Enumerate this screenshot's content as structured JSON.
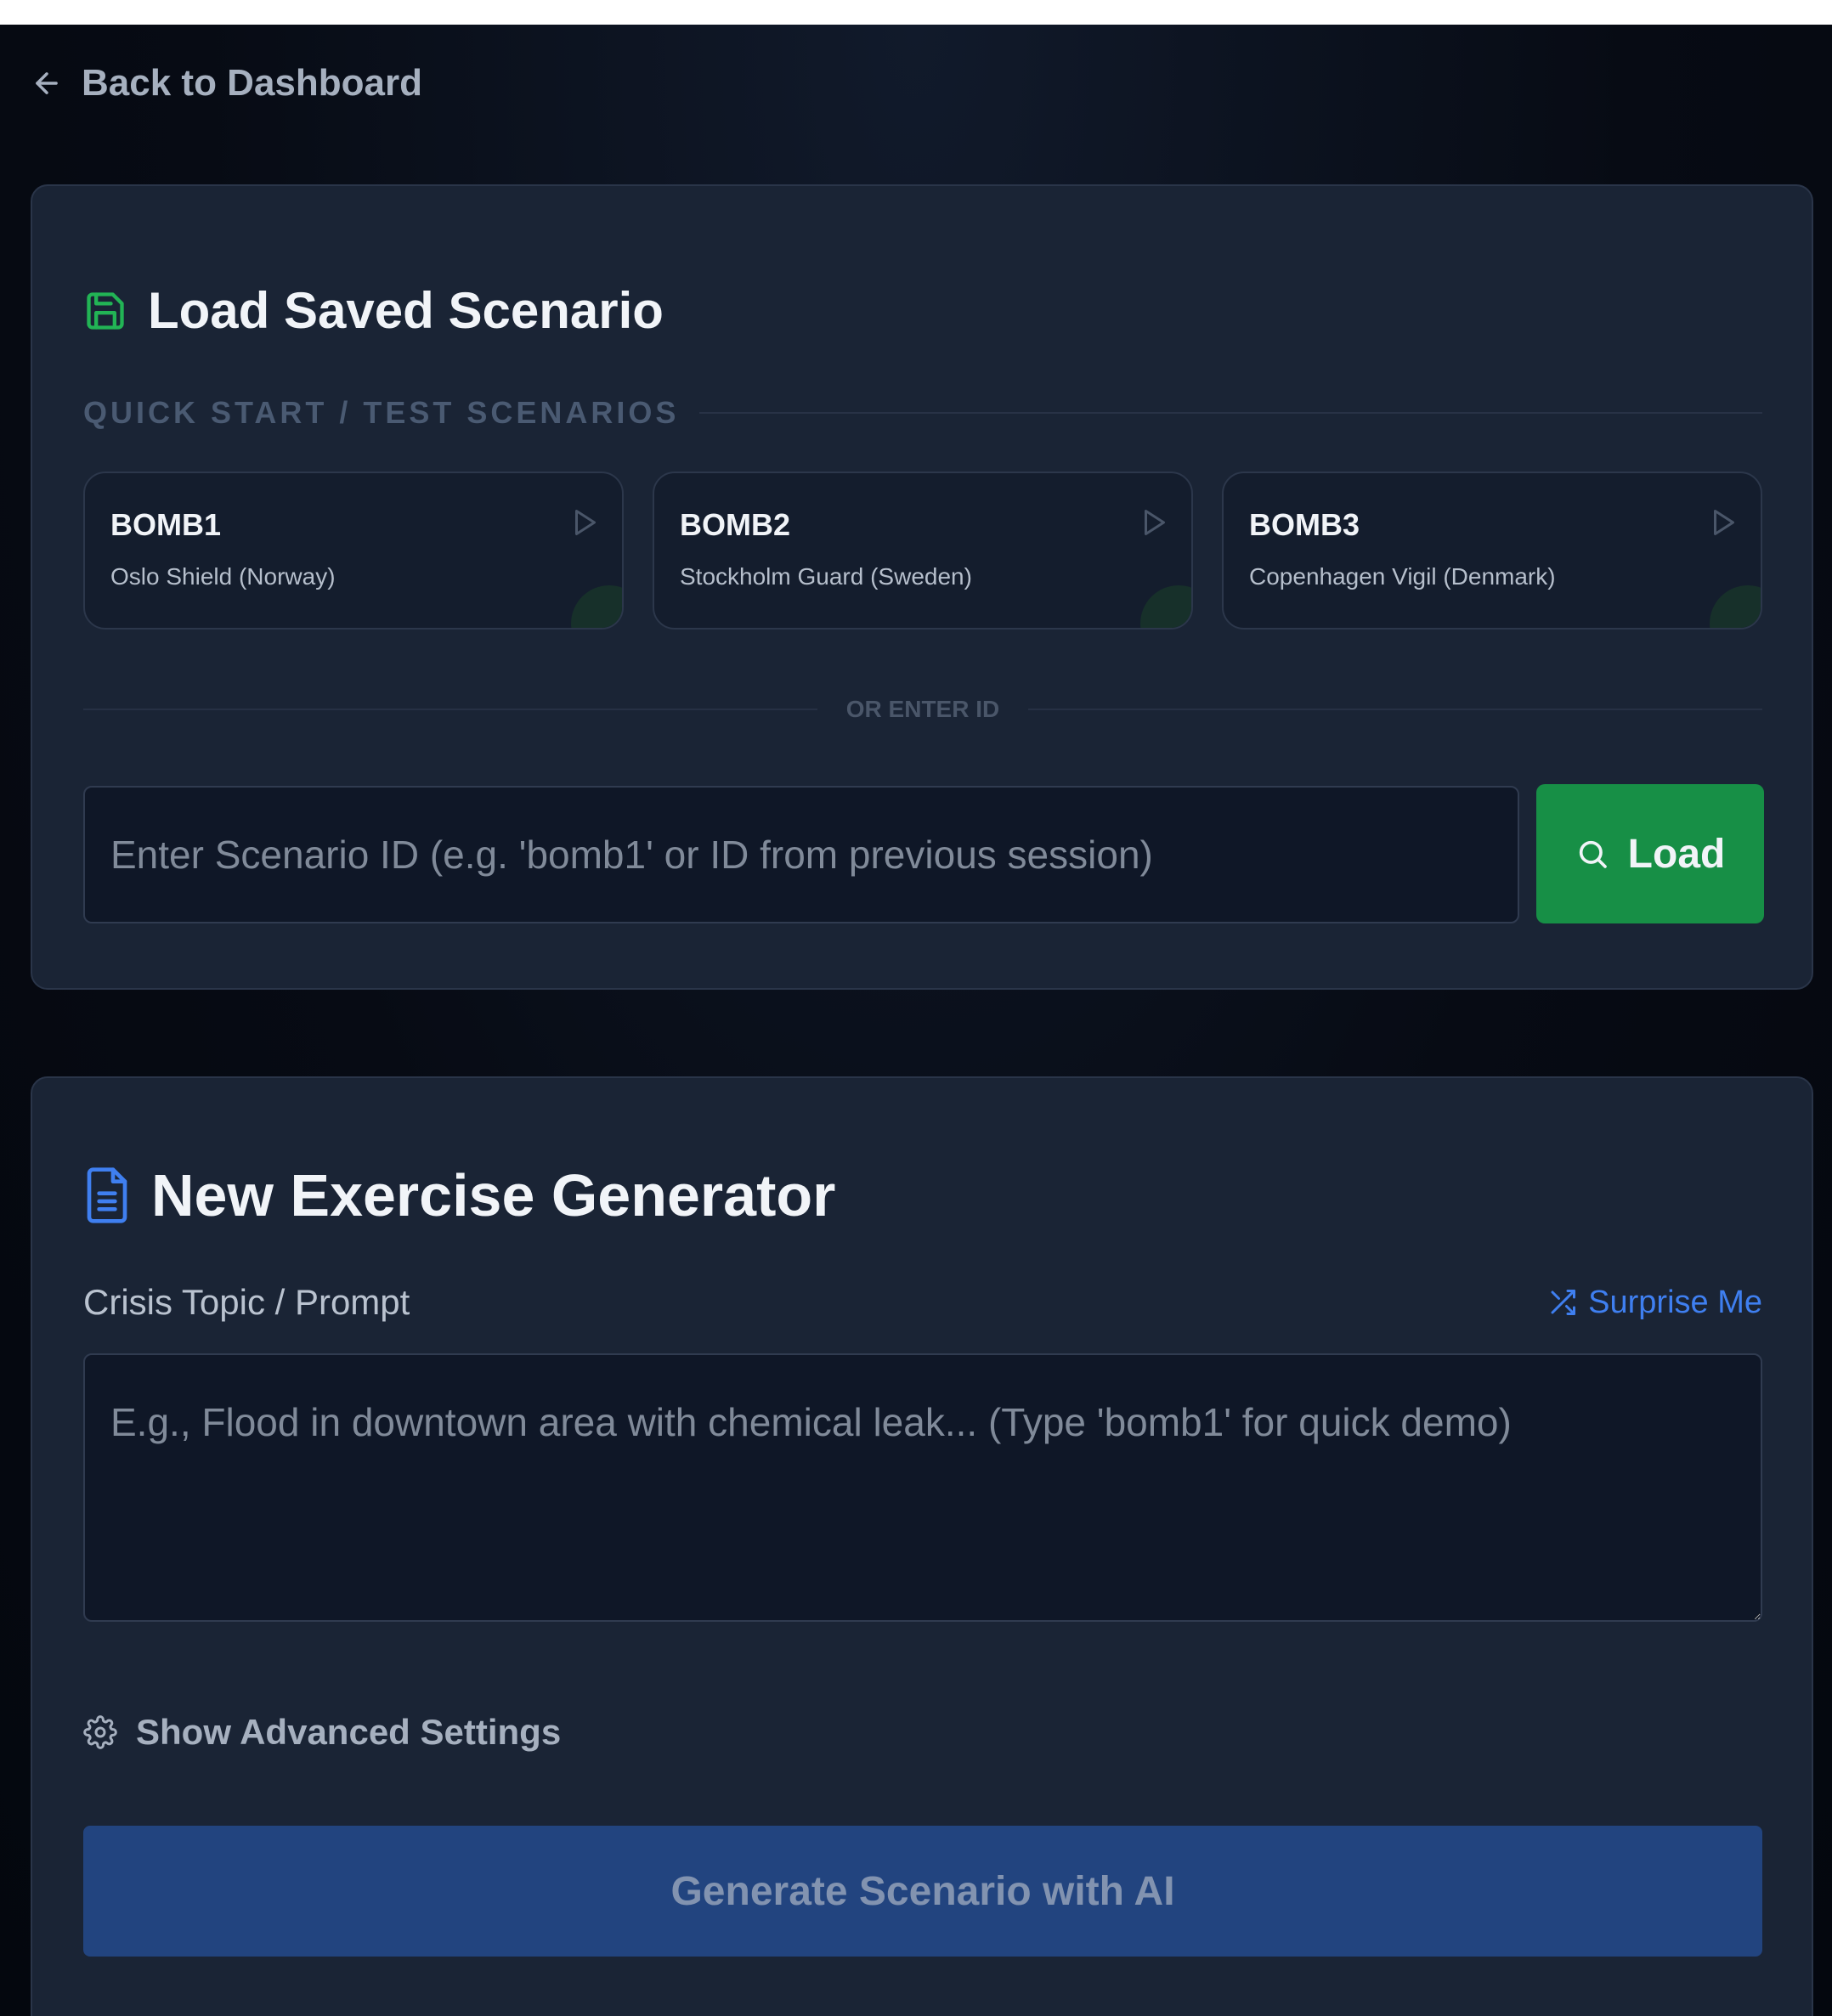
{
  "nav": {
    "back_label": "Back to Dashboard"
  },
  "load_panel": {
    "title": "Load Saved Scenario",
    "quick_start_label": "QUICK START / TEST SCENARIOS",
    "scenarios": [
      {
        "id": "BOMB1",
        "name": "Oslo Shield (Norway)"
      },
      {
        "id": "BOMB2",
        "name": "Stockholm Guard (Sweden)"
      },
      {
        "id": "BOMB3",
        "name": "Copenhagen Vigil (Denmark)"
      }
    ],
    "divider_label": "OR ENTER ID",
    "id_input": {
      "value": "",
      "placeholder": "Enter Scenario ID (e.g. 'bomb1' or ID from previous session)"
    },
    "load_button_label": "Load"
  },
  "generator_panel": {
    "title": "New Exercise Generator",
    "prompt_label": "Crisis Topic / Prompt",
    "surprise_label": "Surprise Me",
    "prompt_input": {
      "value": "",
      "placeholder": "E.g., Flood in downtown area with chemical leak... (Type 'bomb1' for quick demo)"
    },
    "advanced_label": "Show Advanced Settings",
    "generate_button_label": "Generate Scenario with AI"
  },
  "icons": {
    "back": "arrow-left-icon",
    "load_title": "save-icon",
    "scenario_play": "play-icon",
    "load_button": "search-icon",
    "generator_title": "file-text-icon",
    "surprise": "shuffle-icon",
    "advanced": "gear-icon"
  },
  "colors": {
    "background": "#070b14",
    "card": "#1a2435",
    "accent_green": "#178f46",
    "accent_blue": "#3f7ff0",
    "generate_button": "#22447f"
  }
}
